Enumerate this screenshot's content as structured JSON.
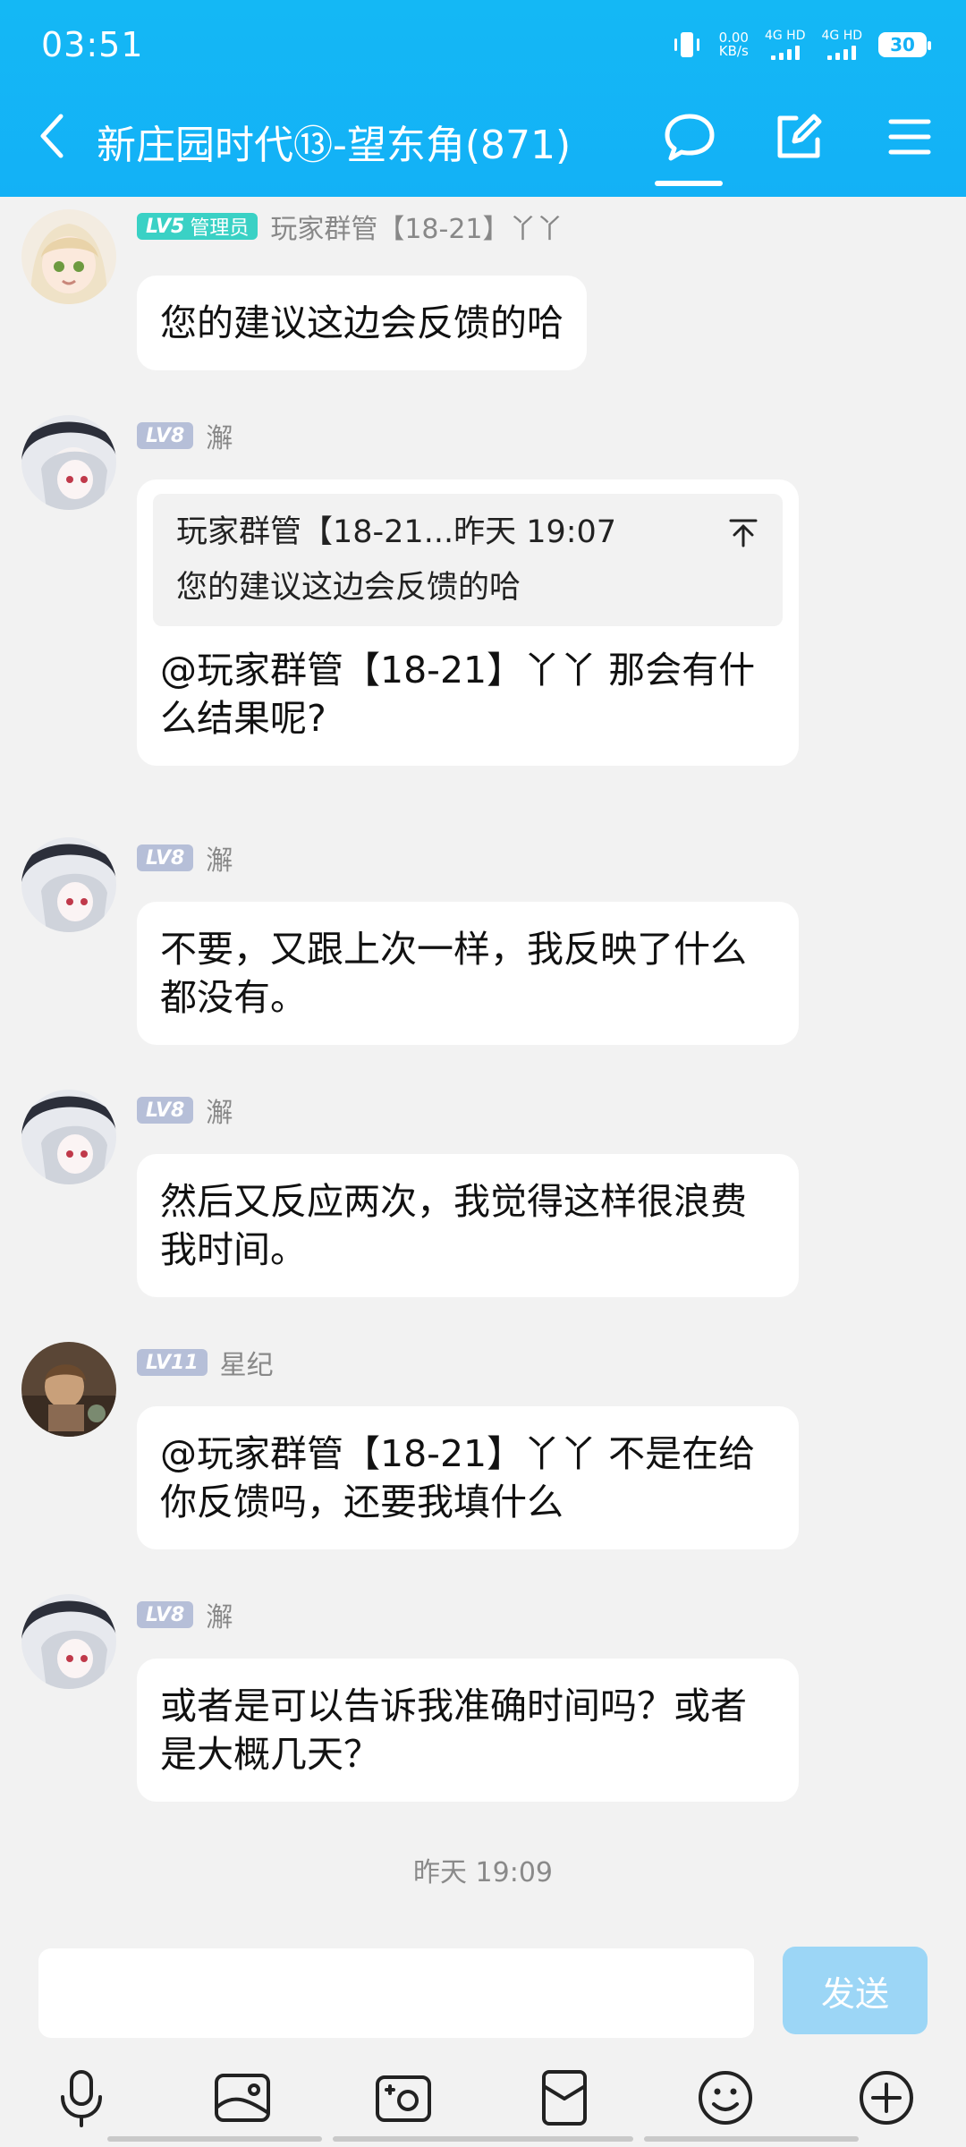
{
  "status_bar": {
    "time": "03:51",
    "net_speed": "0.00",
    "net_unit": "KB/s",
    "sig1": "4G HD",
    "sig2": "4G HD",
    "battery": "30"
  },
  "header": {
    "title": "新庄园时代⑬-望东角(871)",
    "icons": [
      "back-icon",
      "chat-bubble-icon",
      "edit-icon",
      "menu-icon"
    ]
  },
  "messages": [
    {
      "level": "LV5",
      "role": "管理员",
      "name": "玩家群管【18-21】丫丫",
      "text": "您的建议这边会反馈的哈"
    },
    {
      "level": "LV8",
      "name": "澥",
      "quote_head": "玩家群管【18-21...昨天 19:07",
      "quote_text": "您的建议这边会反馈的哈",
      "text": "@玩家群管【18-21】丫丫 那会有什么结果呢?"
    },
    {
      "level": "LV8",
      "name": "澥",
      "text": "不要，又跟上次一样，我反映了什么都没有。"
    },
    {
      "level": "LV8",
      "name": "澥",
      "text": "然后又反应两次，我觉得这样很浪费我时间。"
    },
    {
      "level": "LV11",
      "name": "星纪",
      "text": "@玩家群管【18-21】丫丫 不是在给你反馈吗，还要我填什么"
    },
    {
      "level": "LV8",
      "name": "澥",
      "text": "或者是可以告诉我准确时间吗？或者是大概几天？"
    }
  ],
  "timestamp": "昨天 19:09",
  "input": {
    "placeholder": "",
    "send_label": "发送"
  },
  "toolbar": [
    "microphone-icon",
    "image-icon",
    "camera-icon",
    "red-packet-icon",
    "emoji-icon",
    "plus-icon"
  ],
  "colors": {
    "brand": "#13b1f6",
    "send_disabled": "#9cd6f6",
    "admin_badge": "#3ad1c5",
    "level_badge": "#b6bfd8"
  }
}
